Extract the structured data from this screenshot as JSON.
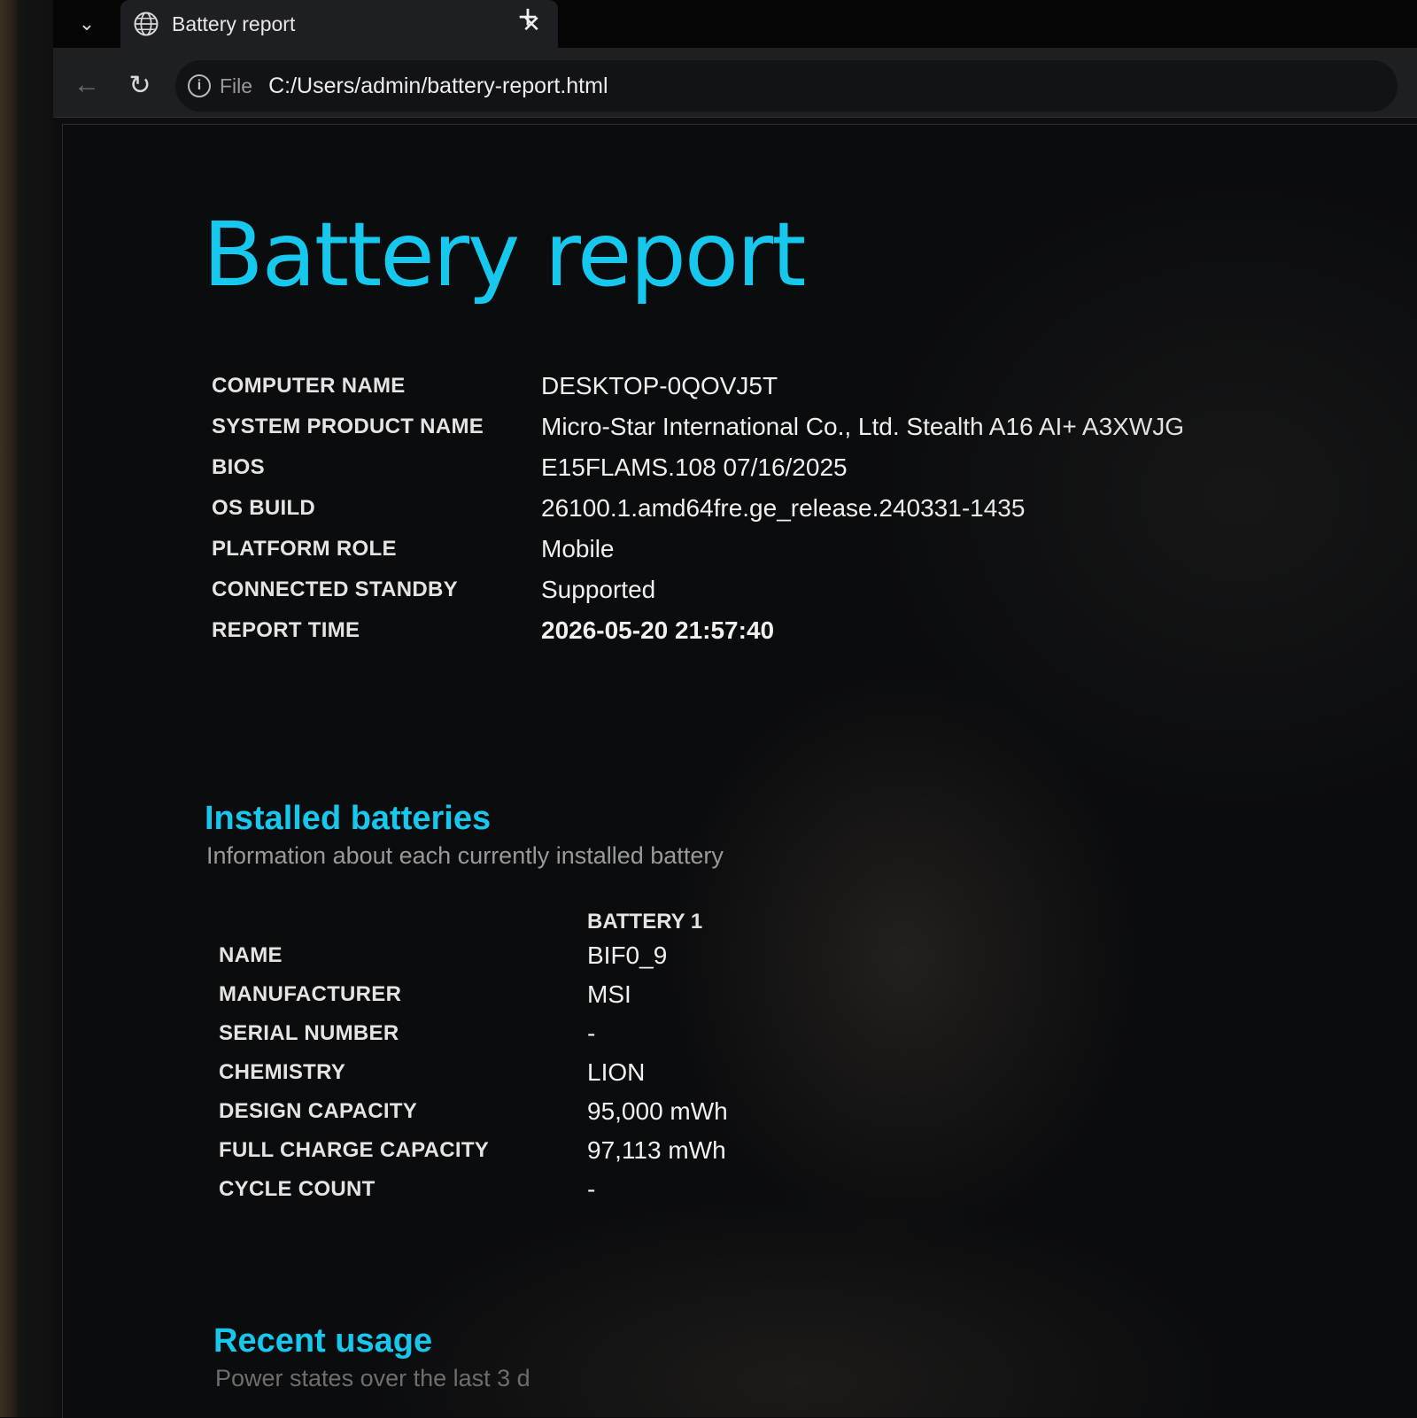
{
  "browser": {
    "tab": {
      "title": "Battery report",
      "close_glyph": "✕",
      "icon": "globe-icon"
    },
    "new_tab_glyph": "+",
    "tab_menu_glyph": "⌄",
    "toolbar": {
      "back_glyph": "←",
      "reload_glyph": "↻",
      "info_glyph": "i",
      "scheme_label": "File",
      "url": "C:/Users/admin/battery-report.html"
    }
  },
  "report": {
    "title": "Battery report",
    "system_info": [
      {
        "label": "COMPUTER NAME",
        "value": "DESKTOP-0QOVJ5T"
      },
      {
        "label": "SYSTEM PRODUCT NAME",
        "value": "Micro-Star International Co., Ltd. Stealth A16 AI+ A3XWJG"
      },
      {
        "label": "BIOS",
        "value": "E15FLAMS.108 07/16/2025"
      },
      {
        "label": "OS BUILD",
        "value": "26100.1.amd64fre.ge_release.240331-1435"
      },
      {
        "label": "PLATFORM ROLE",
        "value": "Mobile"
      },
      {
        "label": "CONNECTED STANDBY",
        "value": "Supported"
      },
      {
        "label": "REPORT TIME",
        "value": "2026-05-20  21:57:40"
      }
    ],
    "installed_batteries": {
      "title": "Installed batteries",
      "subtitle": "Information about each currently installed battery",
      "column_header": "BATTERY 1",
      "rows": [
        {
          "label": "NAME",
          "value": "BIF0_9"
        },
        {
          "label": "MANUFACTURER",
          "value": "MSI"
        },
        {
          "label": "SERIAL NUMBER",
          "value": "-"
        },
        {
          "label": "CHEMISTRY",
          "value": "LION"
        },
        {
          "label": "DESIGN CAPACITY",
          "value": "95,000 mWh"
        },
        {
          "label": "FULL CHARGE CAPACITY",
          "value": "97,113 mWh"
        },
        {
          "label": "CYCLE COUNT",
          "value": "-"
        }
      ]
    },
    "recent_usage": {
      "title": "Recent usage",
      "subtitle": "Power states over the last 3 d"
    }
  },
  "colors": {
    "accent": "#16c8ee",
    "background": "#0b0c0e"
  }
}
